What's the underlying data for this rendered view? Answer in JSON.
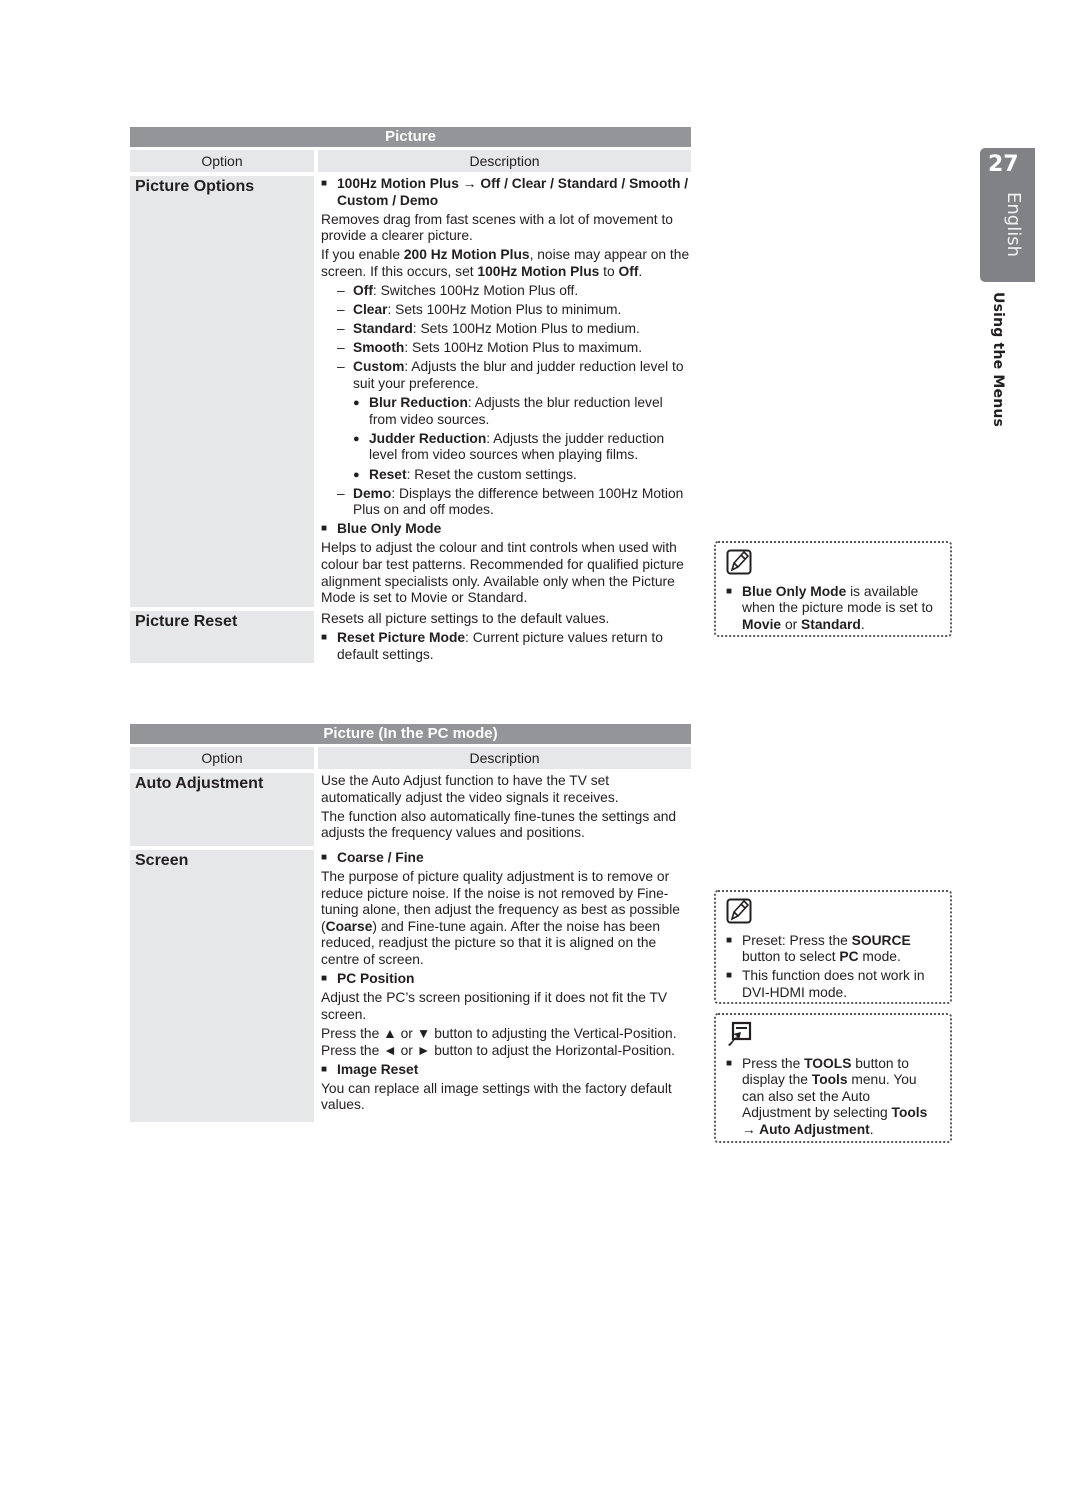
{
  "page": {
    "number": "27",
    "language": "English",
    "section": "Using the Menus"
  },
  "colors": {
    "title_bar": "#939598",
    "column_bg": "#e6e7e8",
    "tab_bg": "#808285"
  },
  "table1": {
    "title": "Picture",
    "col_option": "Option",
    "col_description": "Description",
    "rows": [
      {
        "option": "Picture Options",
        "item1_head_a": "100Hz Motion Plus",
        "item1_head_b": " → Off / Clear / Standard / Smooth / Custom / Demo",
        "item1_p1": "Removes drag from fast scenes with a lot of movement to provide a clearer picture.",
        "item1_p2_a": "If you enable ",
        "item1_p2_b": "200 Hz Motion Plus",
        "item1_p2_c": ", noise may appear on the screen. If this occurs, set ",
        "item1_p2_d": "100Hz Motion Plus",
        "item1_p2_e": " to ",
        "item1_p2_f": "Off",
        "item1_p2_g": ".",
        "dashes": [
          {
            "term": "Off",
            "text": ": Switches 100Hz Motion Plus off."
          },
          {
            "term": "Clear",
            "text": ": Sets 100Hz Motion Plus to minimum."
          },
          {
            "term": "Standard",
            "text": ": Sets 100Hz Motion Plus to medium."
          },
          {
            "term": "Smooth",
            "text": ": Sets 100Hz Motion Plus to maximum."
          },
          {
            "term": "Custom",
            "text": ": Adjusts the blur and judder reduction level to suit your preference."
          }
        ],
        "dots": [
          {
            "term": "Blur Reduction",
            "text": ": Adjusts the blur reduction level from video sources."
          },
          {
            "term": "Judder Reduction",
            "text": ": Adjusts the judder reduction level from video sources when playing films."
          },
          {
            "term": "Reset",
            "text": ": Reset the custom settings."
          }
        ],
        "demo": {
          "term": "Demo",
          "text": ": Displays the difference between 100Hz Motion Plus on and off modes."
        },
        "item2_head": "Blue Only Mode",
        "item2_p": "Helps to adjust the colour and tint controls when used with colour bar test patterns. Recommended for qualified picture alignment specialists only.  Available only when the Picture Mode is set to Movie or Standard."
      },
      {
        "option": "Picture Reset",
        "p": "Resets all picture settings to the default values.",
        "item_term": "Reset Picture Mode",
        "item_text": ": Current picture values return to default settings."
      }
    ]
  },
  "table2": {
    "title": "Picture (In the PC mode)",
    "col_option": "Option",
    "col_description": "Description",
    "rows": [
      {
        "option": "Auto Adjustment",
        "p1": "Use the Auto Adjust function to have the TV set automatically adjust the video signals it receives.",
        "p2": "The function also automatically fine-tunes the settings and adjusts the frequency values and positions."
      },
      {
        "option": "Screen",
        "item1_head": "Coarse / Fine",
        "item1_p_a": "The purpose of picture quality adjustment is to remove or reduce picture noise. If the noise is not removed by Fine-tuning alone, then adjust the frequency as best as possible (",
        "item1_p_b": "Coarse",
        "item1_p_c": ") and Fine-tune again. After the noise has been reduced, readjust the picture so that it is aligned on the centre of screen.",
        "item2_head": "PC Position",
        "item2_p1": "Adjust the PC’s screen positioning if it does not fit the TV screen.",
        "item2_p2": "Press the ▲ or ▼ button to adjusting the Vertical-Position.",
        "item2_p3": "Press the ◄ or ► button to adjust the Horizontal-Position.",
        "item3_head": "Image Reset",
        "item3_p": "You can replace all image settings with the factory default values."
      }
    ]
  },
  "notes": {
    "note1": {
      "icon": "note-pencil-icon",
      "a": "Blue Only Mode",
      "b": " is available when the picture mode is set to ",
      "c": "Movie",
      "d": " or ",
      "e": "Standard",
      "f": "."
    },
    "note2": {
      "icon": "note-pencil-icon",
      "i1_a": "Preset: Press the ",
      "i1_b": "SOURCE",
      "i1_c": " button to select ",
      "i1_d": "PC",
      "i1_e": " mode.",
      "i2": "This function does not work in DVI-HDMI mode."
    },
    "note3": {
      "icon": "tools-icon",
      "a": "Press the ",
      "b": "TOOLS",
      "c": " button to display the ",
      "d": "Tools",
      "e": " menu. You can also set the Auto Adjustment by selecting ",
      "f": "Tools → Auto Adjustment",
      "g": "."
    }
  }
}
